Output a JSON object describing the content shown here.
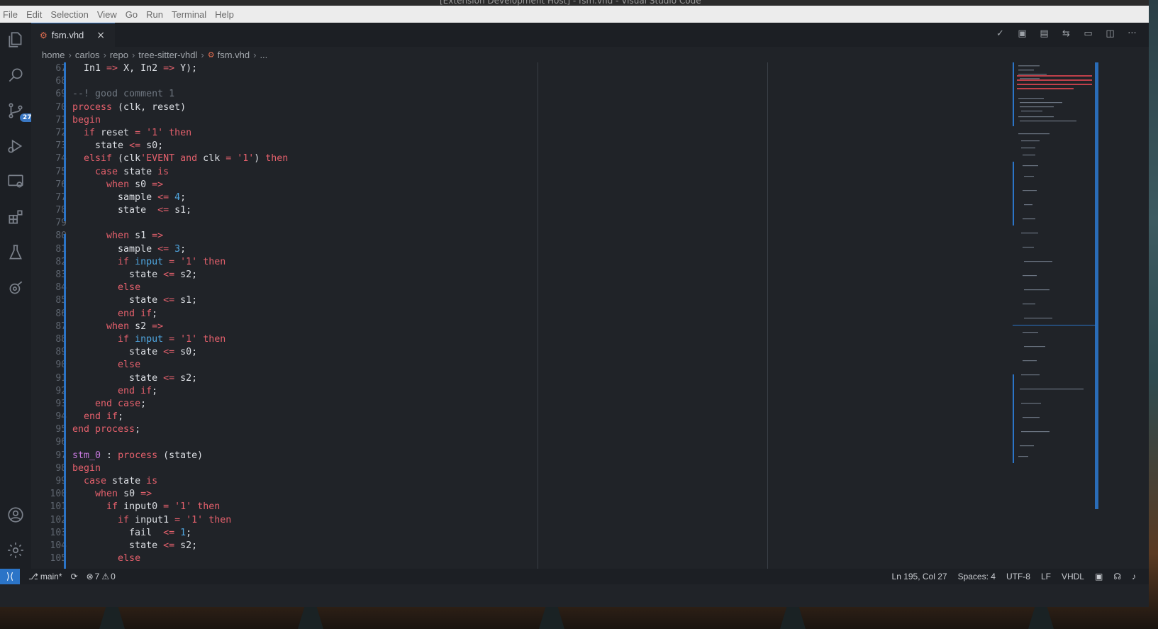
{
  "window": {
    "title": "[Extension Development Host] - fsm.vhd - Visual Studio Code"
  },
  "menu": [
    "File",
    "Edit",
    "Selection",
    "View",
    "Go",
    "Run",
    "Terminal",
    "Help"
  ],
  "activity": {
    "icons": [
      "explorer-icon",
      "search-icon",
      "source-control-icon",
      "run-debug-icon",
      "remote-explorer-icon",
      "extensions-icon",
      "testing-icon",
      "gitlens-icon",
      "account-icon",
      "settings-gear-icon"
    ],
    "scm_badge": "27"
  },
  "tab": {
    "label": "fsm.vhd",
    "close": "×"
  },
  "toolbar": {
    "icons": [
      "check-icon",
      "open-preview-icon",
      "split-editor-icon",
      "git-compare-icon",
      "toggle-layout-icon",
      "split-right-icon",
      "more-actions-icon"
    ]
  },
  "breadcrumb": [
    "home",
    "carlos",
    "repo",
    "tree-sitter-vhdl",
    "fsm.vhd",
    "..."
  ],
  "editor": {
    "line_numbers": [
      "67",
      "68",
      "69",
      "70",
      "71",
      "72",
      "73",
      "74",
      "75",
      "76",
      "77",
      "78",
      "79",
      "80",
      "81",
      "82",
      "83",
      "84",
      "85",
      "86",
      "87",
      "88",
      "89",
      "90",
      "91",
      "92",
      "93",
      "94",
      "95",
      "96",
      "97",
      "98",
      "99",
      "100",
      "101",
      "102",
      "103",
      "104",
      "105"
    ]
  },
  "status": {
    "branch": "main*",
    "errors": "7",
    "warnings": "0",
    "cursor": "Ln 195, Col 27",
    "spaces": "Spaces: 4",
    "encoding": "UTF-8",
    "eol": "LF",
    "language": "VHDL"
  },
  "colors": {
    "accent": "#2b74c7",
    "keyword": "#e4606c",
    "number": "#4fa6e0",
    "comment": "#6f7781",
    "identifier": "#c678dd"
  }
}
